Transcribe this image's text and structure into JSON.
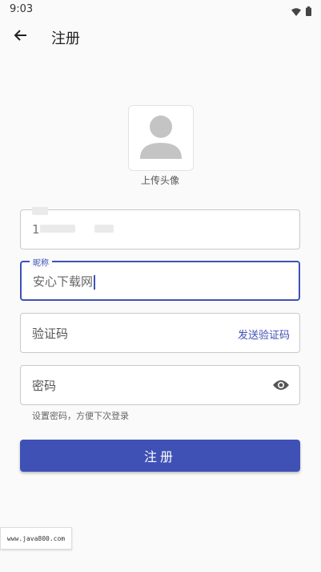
{
  "status_bar": {
    "time": "9:03"
  },
  "app_bar": {
    "title": "注册"
  },
  "avatar": {
    "label": "上传头像"
  },
  "phone_field": {
    "value": "1"
  },
  "nickname_field": {
    "label": "昵称",
    "value": "安心下载网"
  },
  "code_field": {
    "placeholder": "验证码",
    "send_label": "发送验证码"
  },
  "password_field": {
    "placeholder": "密码",
    "hint": "设置密码，方便下次登录"
  },
  "register_button": {
    "label": "注册"
  },
  "watermark": {
    "text": "www.java800.com"
  },
  "colors": {
    "accent": "#3f51b5",
    "background": "#fafafa"
  }
}
